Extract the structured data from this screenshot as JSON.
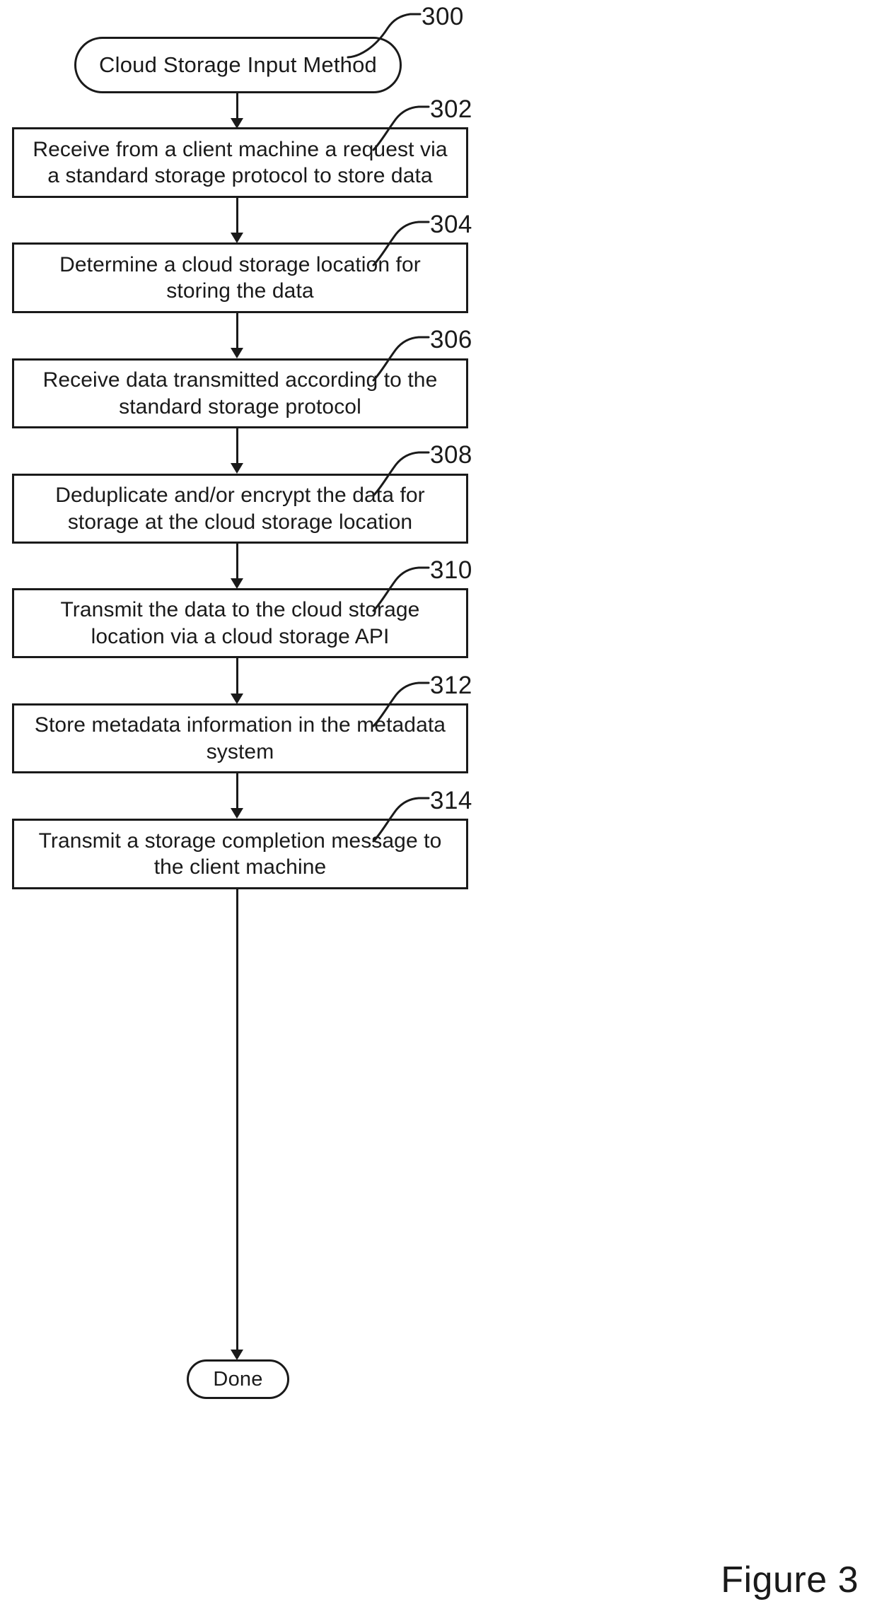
{
  "figure": {
    "caption": "Figure 3",
    "start_ref": "300",
    "end_label": "Done"
  },
  "nodes": {
    "start": {
      "ref": "300",
      "label": "Cloud Storage Input Method",
      "shape": "terminator"
    },
    "steps": [
      {
        "ref": "302",
        "label": "Receive from a client machine a request via a standard storage protocol to store data",
        "shape": "process"
      },
      {
        "ref": "304",
        "label": "Determine a cloud storage location for storing the data",
        "shape": "process"
      },
      {
        "ref": "306",
        "label": "Receive data transmitted according to the standard storage protocol",
        "shape": "process"
      },
      {
        "ref": "308",
        "label": "Deduplicate and/or encrypt the data for storage at the cloud storage location",
        "shape": "process"
      },
      {
        "ref": "310",
        "label": "Transmit the data to the cloud storage location via a cloud storage API",
        "shape": "process"
      },
      {
        "ref": "312",
        "label": "Store metadata information in the metadata system",
        "shape": "process"
      },
      {
        "ref": "314",
        "label": "Transmit a storage completion message to the client machine",
        "shape": "process"
      }
    ],
    "end": {
      "label": "Done",
      "shape": "terminator"
    }
  },
  "colors": {
    "ink": "#1a1a1a",
    "paper": "#ffffff"
  }
}
